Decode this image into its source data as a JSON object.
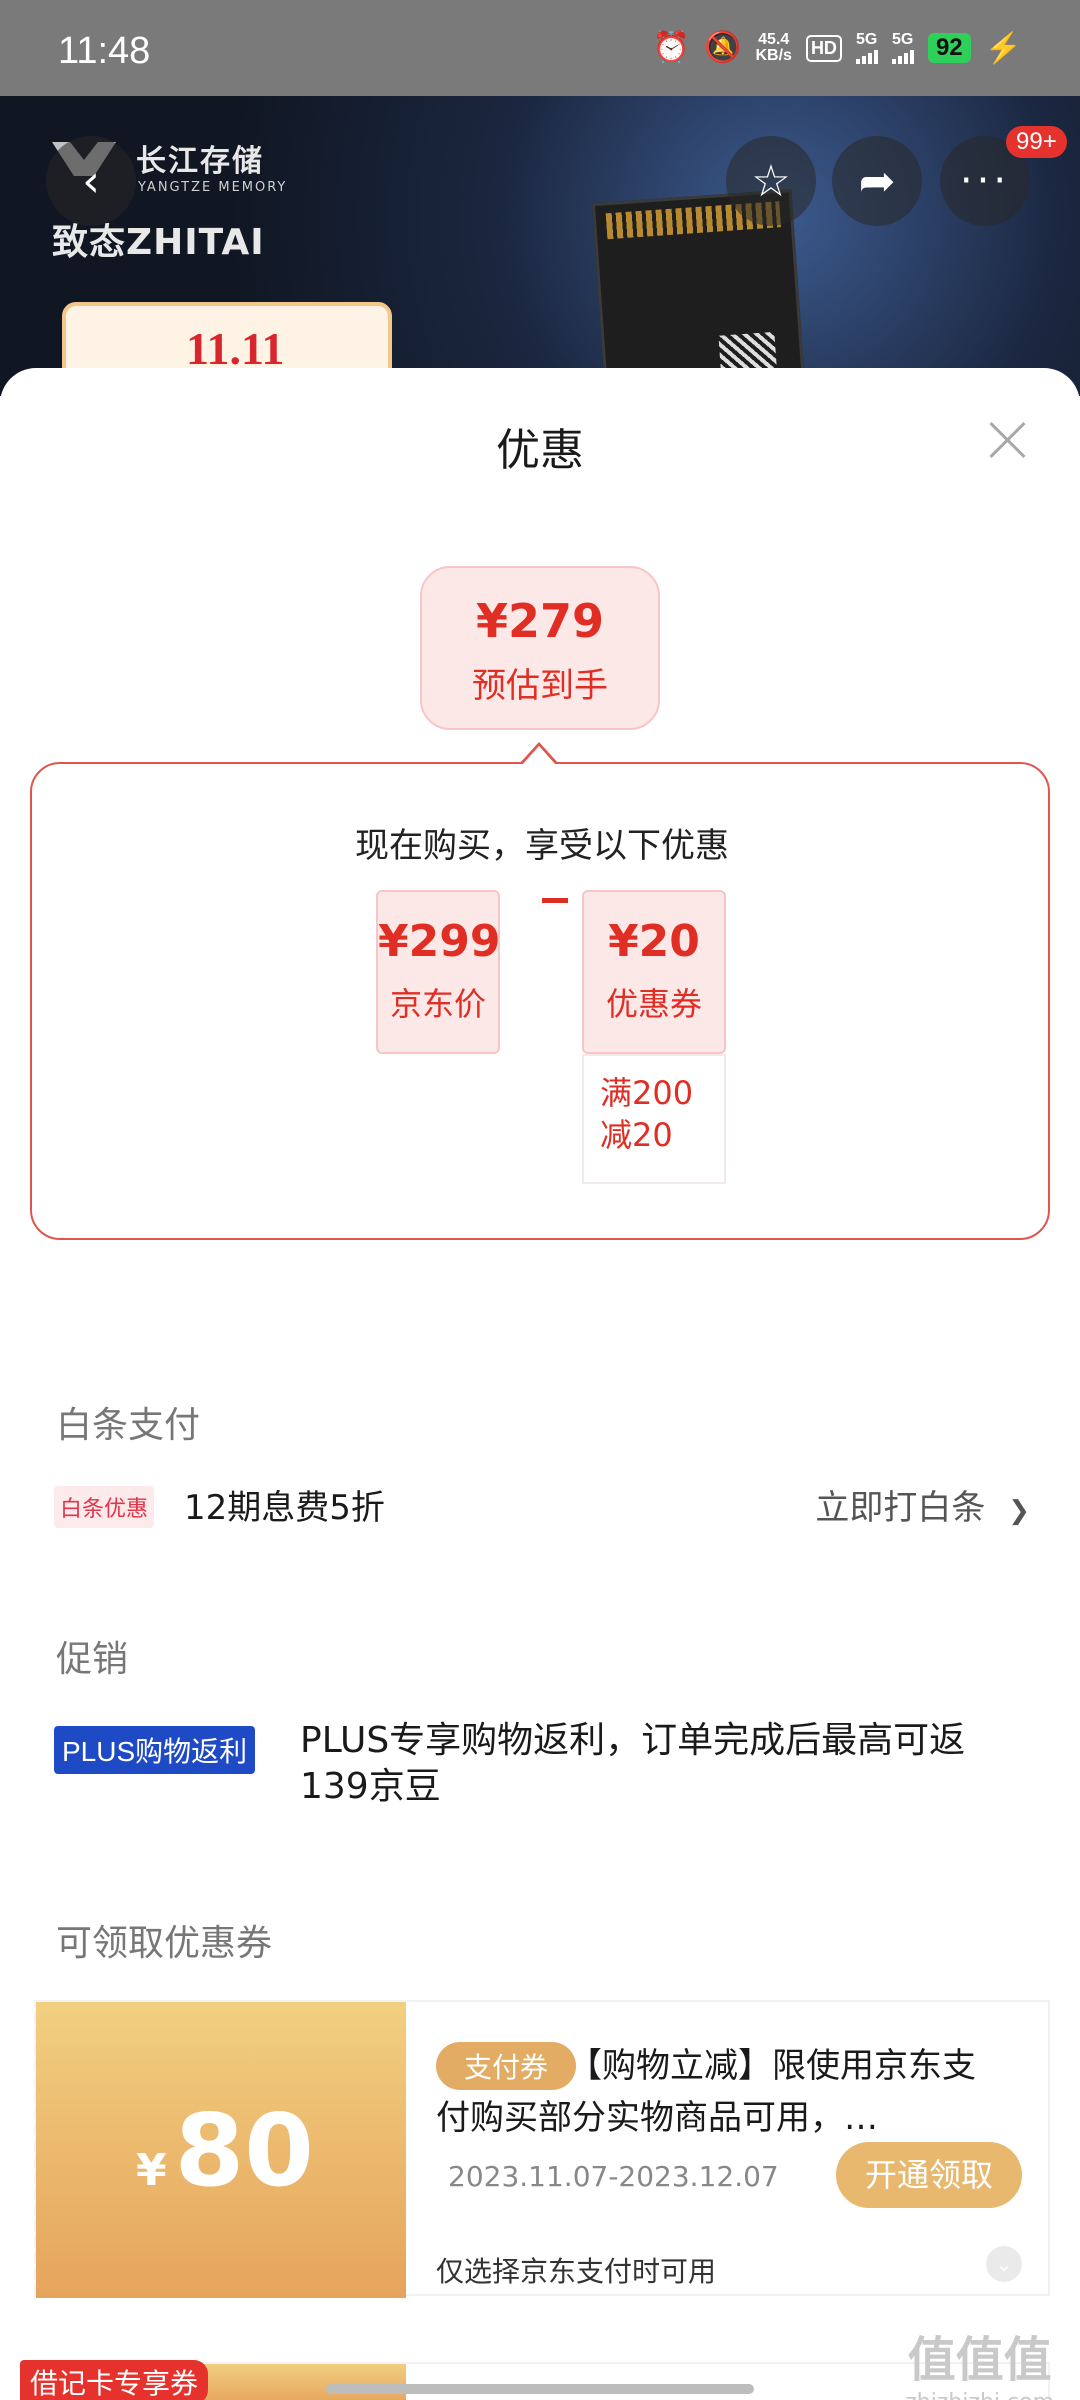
{
  "status_bar": {
    "time": "11:48",
    "net_speed_value": "45.4",
    "net_speed_unit": "KB/s",
    "hd": "HD",
    "sim1": "5G",
    "sim2": "5G",
    "battery": "92"
  },
  "product": {
    "brand_cn": "长江存储",
    "brand_en": "YANGTZE MEMORY",
    "brand2": "致态ZHITAI",
    "badge": "11.11",
    "notification_count": "99+"
  },
  "sheet": {
    "title": "优惠",
    "estimate": {
      "price": "¥279",
      "label": "预估到手"
    },
    "promo": {
      "title": "现在购买，享受以下优惠",
      "jd_price": {
        "value": "¥299",
        "label": "京东价"
      },
      "coupon": {
        "value": "¥20",
        "label": "优惠券"
      },
      "condition": "满200减20"
    },
    "baitiao": {
      "section": "白条支付",
      "tag": "白条优惠",
      "text": "12期息费5折",
      "link": "立即打白条",
      "chevron": "❯"
    },
    "promotion": {
      "section": "促销",
      "tag": "PLUS购物返利",
      "text": "PLUS专享购物返利，订单完成后最高可返139京豆"
    },
    "coupons": {
      "section": "可领取优惠券",
      "items": [
        {
          "currency": "¥",
          "amount": "80",
          "tag": "支付券",
          "title": "【购物立减】限使用京东支付购买部分实物商品可用，…",
          "date": "2023.11.07-2023.12.07",
          "button": "开通领取",
          "note": "仅选择京东支付时可用"
        }
      ],
      "debit_tag": "借记卡专享券"
    }
  },
  "watermark": {
    "glyphs": "值值值",
    "url": "zhizhizhi.com"
  }
}
